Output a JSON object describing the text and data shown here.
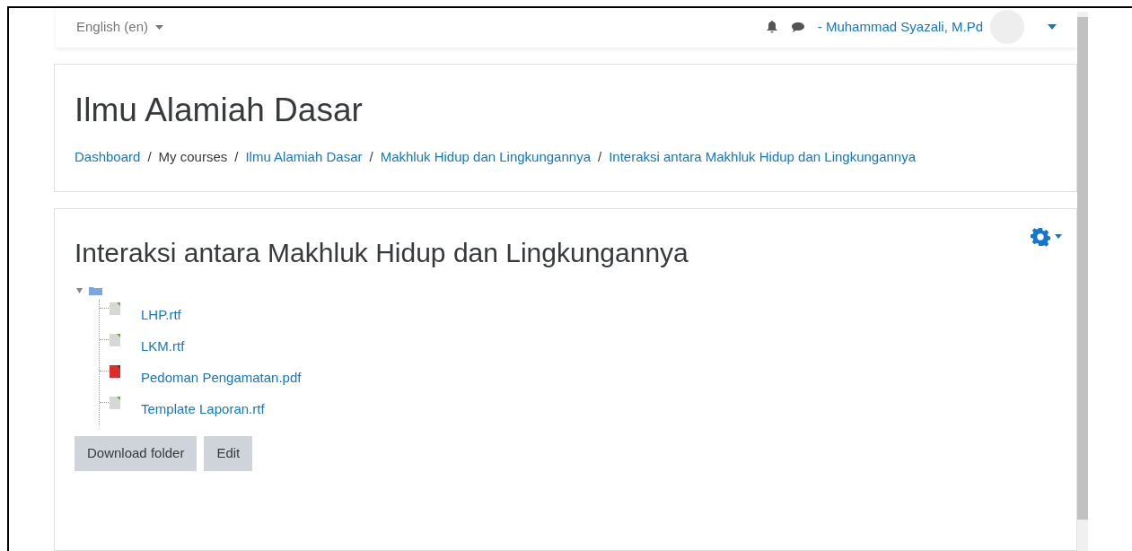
{
  "navbar": {
    "language": "English (en)",
    "user_name": "- Muhammad Syazali, M.Pd"
  },
  "header": {
    "title": "Ilmu Alamiah Dasar",
    "separators": [
      "/",
      "/",
      "/",
      "/"
    ],
    "breadcrumbs": [
      {
        "label": "Dashboard",
        "link": true
      },
      {
        "label": "My courses",
        "link": false
      },
      {
        "label": "Ilmu Alamiah Dasar",
        "link": true
      },
      {
        "label": "Makhluk Hidup dan Lingkungannya",
        "link": true
      },
      {
        "label": "Interaksi antara Makhluk Hidup dan Lingkungannya",
        "link": true
      }
    ]
  },
  "folder": {
    "title": "Interaksi antara Makhluk Hidup dan Lingkungannya",
    "expanded": true,
    "children": [
      {
        "name": "LHP.rtf",
        "kind": "rtf"
      },
      {
        "name": "LKM.rtf",
        "kind": "rtf"
      },
      {
        "name": "Pedoman Pengamatan.pdf",
        "kind": "pdf"
      },
      {
        "name": "Template Laporan.rtf",
        "kind": "rtf"
      }
    ]
  },
  "buttons": [
    "Download folder",
    "Edit"
  ]
}
